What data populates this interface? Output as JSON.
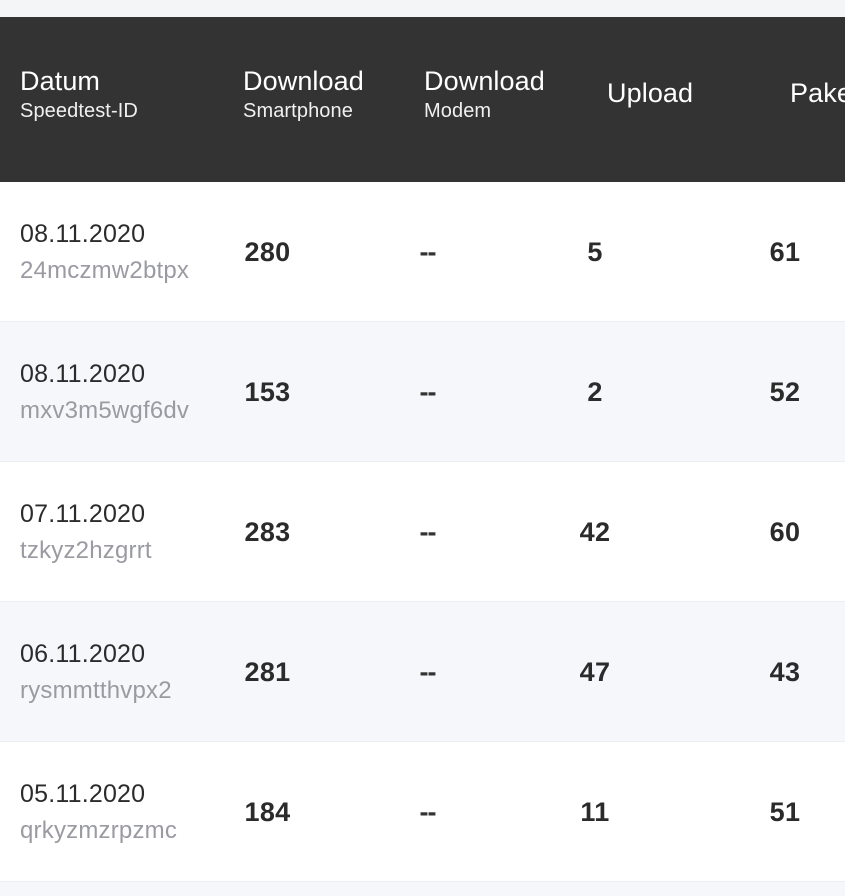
{
  "table": {
    "columns": [
      {
        "key": "datum",
        "title": "Datum",
        "subtitle": "Speedtest-ID"
      },
      {
        "key": "dl_phone",
        "title": "Download",
        "subtitle": "Smartphone"
      },
      {
        "key": "dl_modem",
        "title": "Download",
        "subtitle": "Modem"
      },
      {
        "key": "upload",
        "title": "Upload",
        "subtitle": ""
      },
      {
        "key": "paket",
        "title": "Pake",
        "subtitle": ""
      }
    ],
    "rows": [
      {
        "date": "08.11.2020",
        "id": "24mczmw2btpx",
        "download_smartphone": "280",
        "download_modem": "--",
        "upload": "5",
        "paket": "61"
      },
      {
        "date": "08.11.2020",
        "id": "mxv3m5wgf6dv",
        "download_smartphone": "153",
        "download_modem": "--",
        "upload": "2",
        "paket": "52"
      },
      {
        "date": "07.11.2020",
        "id": "tzkyz2hzgrrt",
        "download_smartphone": "283",
        "download_modem": "--",
        "upload": "42",
        "paket": "60"
      },
      {
        "date": "06.11.2020",
        "id": "rysmmtthvpx2",
        "download_smartphone": "281",
        "download_modem": "--",
        "upload": "47",
        "paket": "43"
      },
      {
        "date": "05.11.2020",
        "id": "qrkyzmzrpzmc",
        "download_smartphone": "184",
        "download_modem": "--",
        "upload": "11",
        "paket": "51"
      }
    ]
  },
  "colors": {
    "header_bg": "#333333",
    "header_text": "#ffffff",
    "row_bg": "#ffffff",
    "row_alt_bg": "#f6f7fb",
    "value_text": "#2b2b2b",
    "id_text": "#9a9ba2",
    "top_strip": "#f4f5f6",
    "divider": "#eceef4"
  }
}
